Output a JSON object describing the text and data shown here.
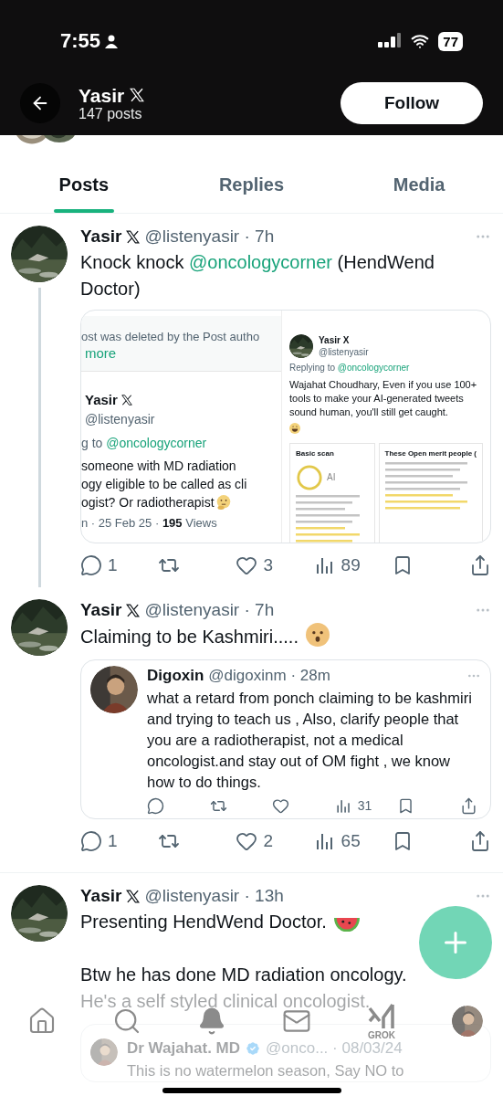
{
  "status_bar": {
    "time": "7:55",
    "battery": "77"
  },
  "header": {
    "name": "Yasir",
    "posts": "147 posts",
    "follow": "Follow"
  },
  "tabs": [
    {
      "label": "Posts",
      "selected": true
    },
    {
      "label": "Replies",
      "selected": false
    },
    {
      "label": "Media",
      "selected": false
    }
  ],
  "posts": [
    {
      "name": "Yasir",
      "handle": "@listenyasir",
      "sep": "·",
      "time": "7h",
      "thread": true,
      "body": [
        {
          "lines": [
            {
              "segments": [
                {
                  "kind": "text",
                  "text": "Knock knock "
                },
                {
                  "kind": "mention",
                  "text": "@oncologycorner"
                },
                {
                  "kind": "text",
                  "text": " (HendWend Doctor)"
                }
              ]
            }
          ]
        }
      ],
      "media": {
        "kind": "screenshot",
        "left": {
          "notice": "ost was deleted by the Post autho",
          "notice_link": "more",
          "name": "Yasir",
          "handle": "@listenyasir",
          "reply_prefix": "g to ",
          "reply_to": "@oncologycorner",
          "lines": [
            "someone with MD radiation",
            "ogy eligible to be called as cli",
            "ogist? Or radiotherapist"
          ],
          "emoji": {
            "kind": "thinking"
          },
          "meta_prefix": "n · 25 Feb 25 · ",
          "views": "195",
          "views_label": " Views"
        },
        "right": {
          "name": "Yasir X",
          "handle": "@listenyasir",
          "reply_prefix": "Replying to ",
          "reply_to": "@oncologycorner",
          "text": "Wajahat Choudhary, Even if you use 100+ tools to make your AI-generated tweets sound human, you'll still get caught.",
          "emoji": {
            "kind": "grin"
          },
          "scan_title": "Basic scan",
          "scan_ring": "AI",
          "article_title": "These Open merit people ("
        }
      },
      "actions": [
        {
          "kind": "reply",
          "count": "1"
        },
        {
          "kind": "repost"
        },
        {
          "kind": "like",
          "count": "3"
        },
        {
          "kind": "views",
          "count": "89"
        },
        {
          "kind": "bookmark"
        },
        {
          "kind": "share"
        }
      ]
    },
    {
      "name": "Yasir",
      "handle": "@listenyasir",
      "sep": "·",
      "time": "7h",
      "thread": false,
      "body": [
        {
          "lines": [
            {
              "segments": [
                {
                  "kind": "text",
                  "text": "Claiming to be Kashmiri....."
                }
              ],
              "emoji": {
                "kind": "hushed"
              }
            }
          ]
        }
      ],
      "quote": {
        "name": "Digoxin",
        "handle": "@digoxinm",
        "sep": "·",
        "time": "28m",
        "verified": false,
        "text": "what a retard from ponch claiming to be kashmiri and trying to teach us , Also, clarify people that you are a radiotherapist, not a medical oncologist.and stay out of OM fight , we know how to do things.",
        "actions": [
          {
            "kind": "reply"
          },
          {
            "kind": "repost"
          },
          {
            "kind": "like"
          },
          {
            "kind": "views",
            "count": "31"
          },
          {
            "kind": "bookmark"
          },
          {
            "kind": "share"
          }
        ]
      },
      "actions": [
        {
          "kind": "reply",
          "count": "1"
        },
        {
          "kind": "repost"
        },
        {
          "kind": "like",
          "count": "2"
        },
        {
          "kind": "views",
          "count": "65"
        },
        {
          "kind": "bookmark"
        },
        {
          "kind": "share"
        }
      ]
    },
    {
      "name": "Yasir",
      "handle": "@listenyasir",
      "sep": "·",
      "time": "13h",
      "thread": false,
      "body": [
        {
          "lines": [
            {
              "segments": [
                {
                  "kind": "text",
                  "text": "Presenting HendWend Doctor."
                }
              ],
              "emoji": {
                "kind": "watermelon"
              }
            }
          ]
        },
        {
          "lines": [
            {
              "segments": [
                {
                  "kind": "text",
                  "text": "Btw he has done MD radiation oncology."
                }
              ]
            },
            {
              "segments": [
                {
                  "kind": "text",
                  "text": "He's a self styled clinical oncologist."
                }
              ]
            }
          ]
        }
      ],
      "quote": {
        "name": "Dr Wajahat. MD",
        "handle": "@onco...",
        "sep": "·",
        "time": "08/03/24",
        "verified": true,
        "text": "This is no watermelon season, Say NO to"
      }
    }
  ],
  "bottom_nav": [
    {
      "kind": "home"
    },
    {
      "kind": "search"
    },
    {
      "kind": "notifications"
    },
    {
      "kind": "messages"
    },
    {
      "kind": "grok",
      "label": "GROK"
    },
    {
      "kind": "profile"
    }
  ]
}
